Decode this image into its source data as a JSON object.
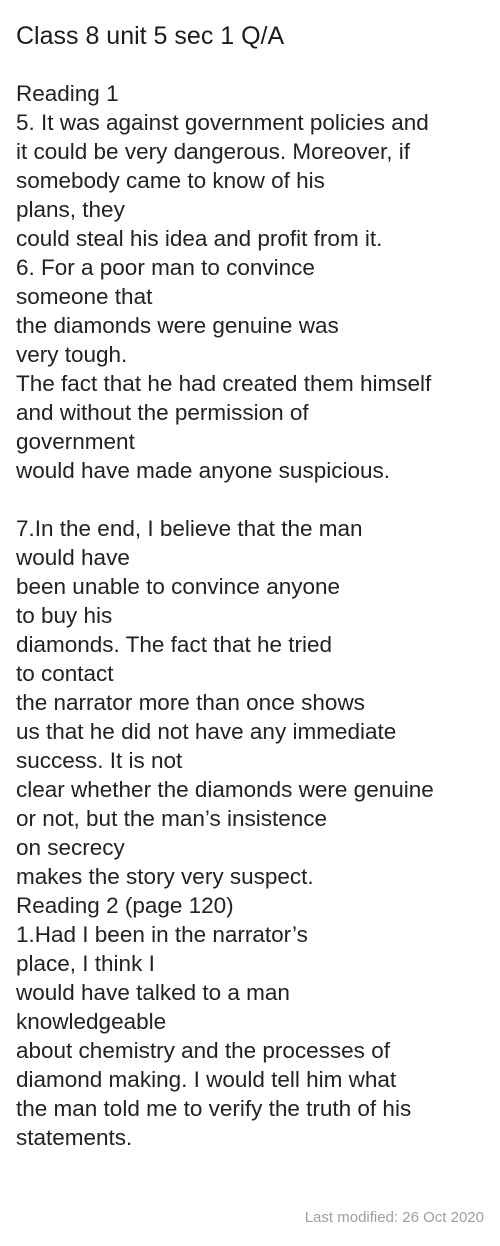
{
  "note": {
    "title": "Class 8 unit 5 sec 1 Q/A",
    "lines": [
      "Reading 1",
      "5. It was against government policies and",
      "it could be very dangerous. Moreover, if",
      "somebody came to know of his",
      "plans, they",
      "could steal his idea and profit from it.",
      "6. For a poor man to convince",
      "someone that",
      "the diamonds were genuine was",
      "very tough.",
      "The fact that he had created them himself",
      "and without the permission of",
      "government",
      "would have made anyone suspicious.",
      "",
      "7.In the end, I believe that the man",
      "would have",
      "been unable to convince anyone",
      "to buy his",
      "diamonds. The fact that he tried",
      "to contact",
      "the narrator more than once shows",
      "us that he did not have any immediate",
      "success. It is not",
      "clear whether the diamonds were genuine",
      "or not, but the man’s insistence",
      "on secrecy",
      "makes the story very suspect.",
      "Reading 2 (page 120)",
      "1.Had I been in the narrator’s",
      "place, I think I",
      "would have talked to a man",
      "knowledgeable",
      "about chemistry and the processes of",
      "diamond making. I would tell him what",
      "the man told me to verify the truth of his",
      "statements."
    ],
    "last_modified": "Last modified: 26 Oct 2020"
  }
}
